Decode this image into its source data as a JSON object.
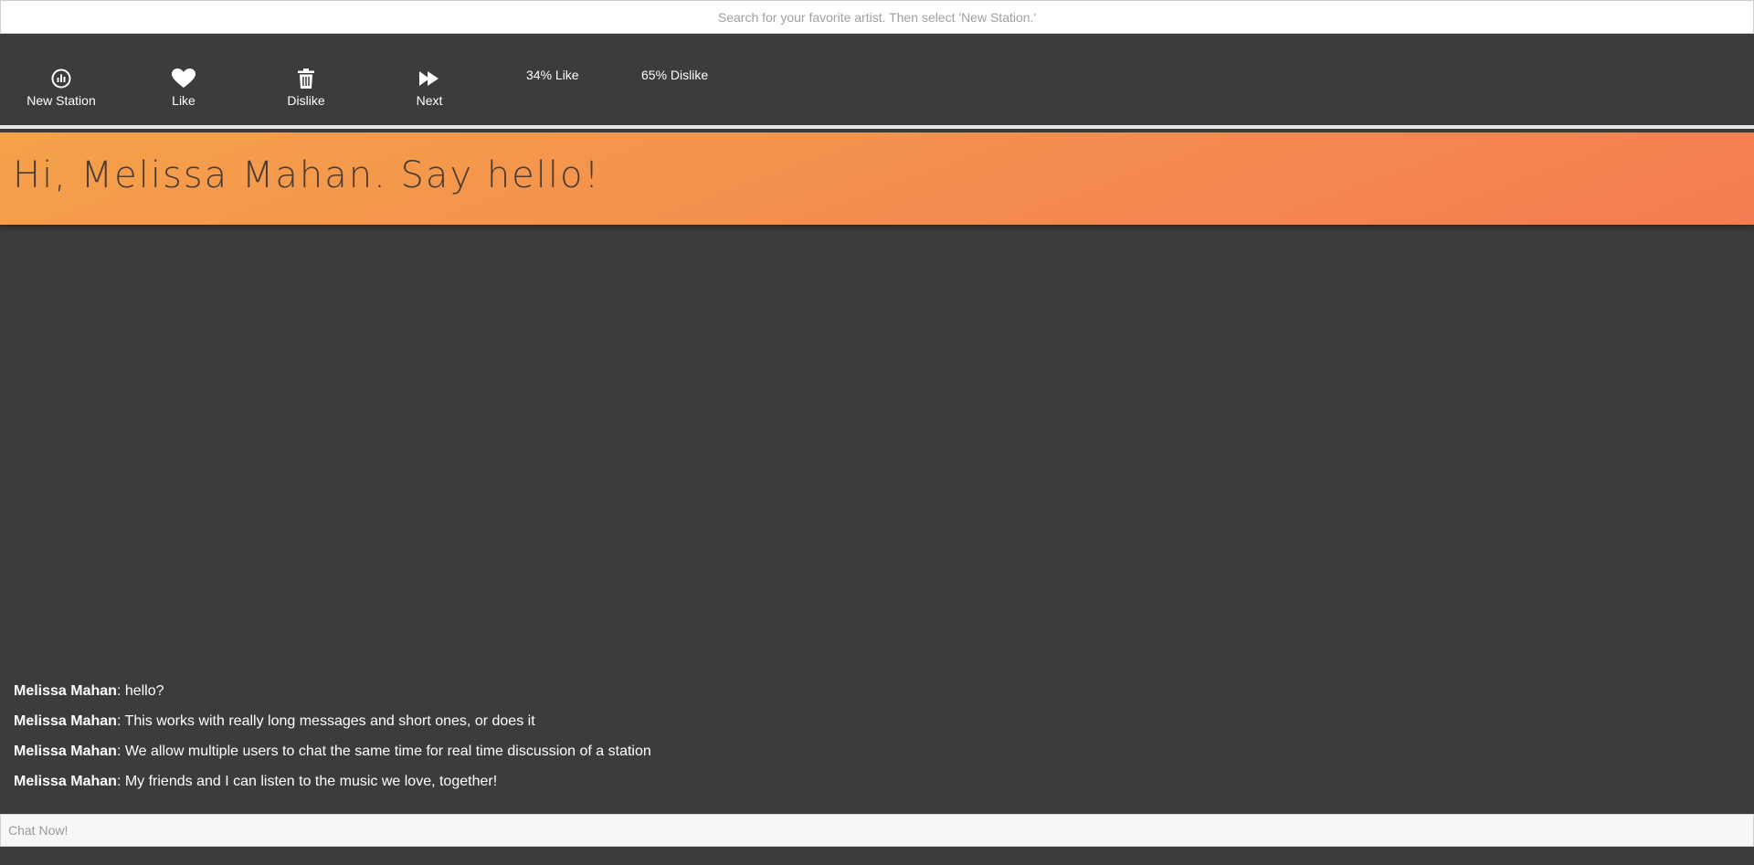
{
  "search": {
    "placeholder": "Search for your favorite artist. Then select 'New Station.'"
  },
  "toolbar": {
    "buttons": [
      {
        "label": "New Station",
        "icon": "radio-station-icon"
      },
      {
        "label": "Like",
        "icon": "heart-icon"
      },
      {
        "label": "Dislike",
        "icon": "trash-icon"
      },
      {
        "label": "Next",
        "icon": "fast-forward-icon"
      }
    ],
    "like_stat": "34% Like",
    "dislike_stat": "65% Dislike"
  },
  "banner": {
    "greeting": "Hi, Melissa Mahan. Say hello!"
  },
  "chat": {
    "messages": [
      {
        "author": "Melissa Mahan",
        "text": ": hello?"
      },
      {
        "author": "Melissa Mahan",
        "text": ": This works with really long messages and short ones, or does it"
      },
      {
        "author": "Melissa Mahan",
        "text": ": We allow multiple users to chat the same time for real time discussion of a station"
      },
      {
        "author": "Melissa Mahan",
        "text": ": My friends and I can listen to the music we love, together!"
      }
    ],
    "input_placeholder": "Chat Now!"
  },
  "colors": {
    "background": "#3c3c3c",
    "banner_start": "#f4a24a",
    "banner_end": "#f47c52",
    "text_light": "#ffffff"
  }
}
